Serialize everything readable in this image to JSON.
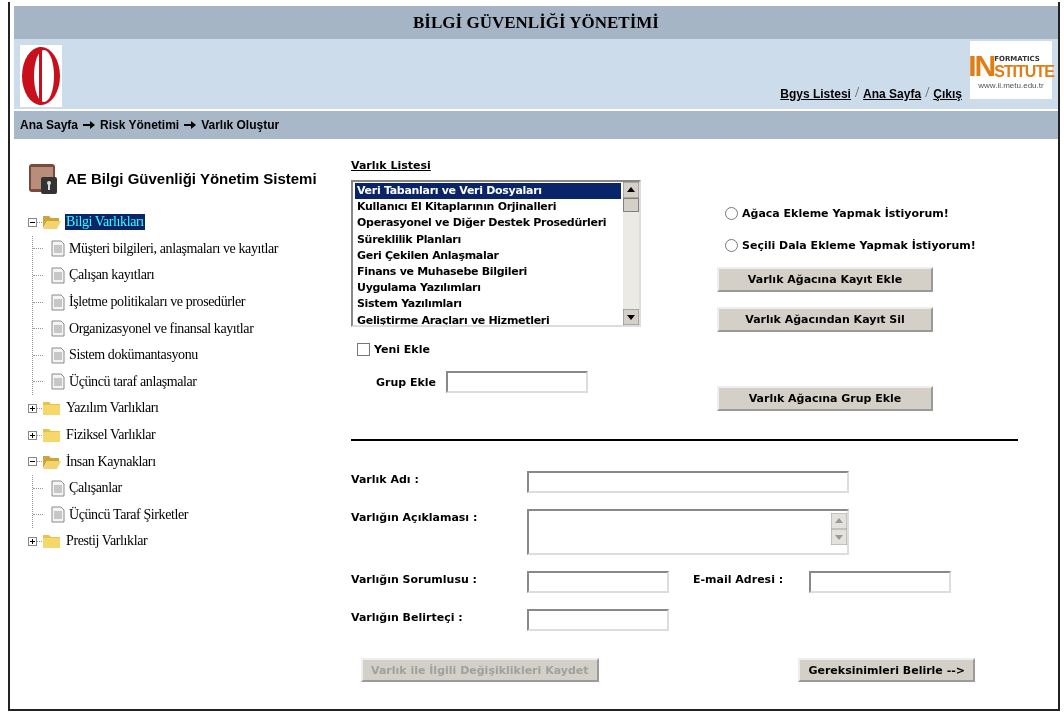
{
  "header": {
    "title": "BİLGİ GÜVENLİĞİ YÖNETİMİ",
    "logo_text": {
      "big": "IN",
      "top": "FORMATICS",
      "bottom": "STITUTE",
      "url": "www.ii.metu.edu.tr"
    },
    "links": [
      "Bgys Listesi",
      "Ana Sayfa",
      "Çıkış"
    ],
    "link_separator": "/"
  },
  "breadcrumb": [
    "Ana Sayfa",
    "Risk Yönetimi",
    "Varlık Oluştur"
  ],
  "sidebar": {
    "title": "AE Bilgi Güvenliği Yönetim Sistemi",
    "tree": [
      {
        "label": "Bilgi Varlıkları",
        "kind": "folder",
        "expanded": true,
        "selected": true,
        "children": [
          {
            "label": "Müşteri bilgileri, anlaşmaları ve kayıtlar",
            "kind": "document",
            "selected": false
          },
          {
            "label": "Çalışan kayıtları",
            "kind": "document",
            "selected": false
          },
          {
            "label": "İşletme politikaları ve prosedürler",
            "kind": "document",
            "selected": false
          },
          {
            "label": "Organizasyonel ve finansal kayıtlar",
            "kind": "document",
            "selected": false
          },
          {
            "label": "Sistem dokümantasyonu",
            "kind": "document",
            "selected": false
          },
          {
            "label": "Üçüncü taraf anlaşmalar",
            "kind": "document",
            "selected": false
          }
        ]
      },
      {
        "label": "Yazılım Varlıkları",
        "kind": "folder",
        "expanded": false,
        "selected": false
      },
      {
        "label": "Fiziksel Varlıklar",
        "kind": "folder",
        "expanded": false,
        "selected": false
      },
      {
        "label": "İnsan Kaynakları",
        "kind": "folder",
        "expanded": true,
        "selected": false,
        "children": [
          {
            "label": "Çalışanlar",
            "kind": "document",
            "selected": false
          },
          {
            "label": "Üçüncü Taraf Şirketler",
            "kind": "document",
            "selected": false
          }
        ]
      },
      {
        "label": "Prestij Varlıklar",
        "kind": "folder",
        "expanded": false,
        "selected": false
      }
    ]
  },
  "asset_list": {
    "label": "Varlık Listesi",
    "items": [
      {
        "label": "Veri Tabanları ve Veri Dosyaları",
        "selected": true
      },
      {
        "label": "Kullanıcı El Kitaplarının Orjinalleri",
        "selected": false
      },
      {
        "label": "Operasyonel ve Diğer Destek Prosedürleri",
        "selected": false
      },
      {
        "label": "Süreklilik Planları",
        "selected": false
      },
      {
        "label": "Geri Çekilen Anlaşmalar",
        "selected": false
      },
      {
        "label": "Finans ve Muhasebe Bilgileri",
        "selected": false
      },
      {
        "label": "Uygulama Yazılımları",
        "selected": false
      },
      {
        "label": "Sistem Yazılımları",
        "selected": false
      },
      {
        "label": "Geliştirme Araçları ve Hizmetleri",
        "selected": false
      }
    ]
  },
  "radios": [
    {
      "label": "Ağaca Ekleme Yapmak İstiyorum!",
      "selected": false
    },
    {
      "label": "Seçili Dala Ekleme Yapmak İstiyorum!",
      "selected": false
    }
  ],
  "tree_buttons": [
    "Varlık Ağacına Kayıt Ekle",
    "Varlık Ağacından Kayıt Sil"
  ],
  "new_checkbox": {
    "label": "Yeni Ekle",
    "checked": false
  },
  "group": {
    "label": "Grup Ekle",
    "button": "Varlık Ağacına Grup Ekle"
  },
  "form": {
    "name": "Varlık Adı :",
    "description": "Varlığın Açıklaması :",
    "owner": "Varlığın Sorumlusu :",
    "email": "E-mail Adresi :",
    "identifier": "Varlığın Belirteçi :"
  },
  "buttons": [
    {
      "label": "Varlık ile İlgili Değişiklikleri Kaydet",
      "disabled": true
    },
    {
      "label": "Gereksinimleri Belirle -->",
      "disabled": false
    }
  ]
}
